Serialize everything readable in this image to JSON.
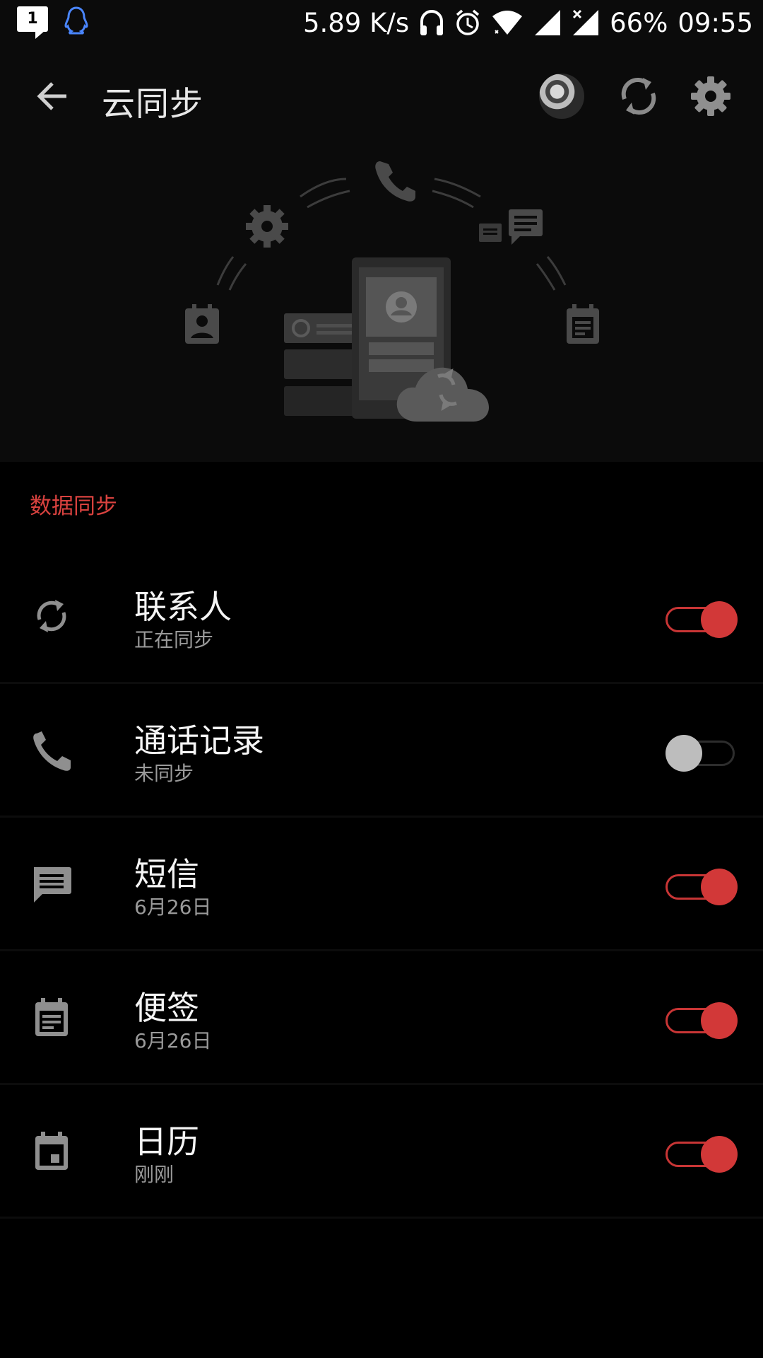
{
  "status_bar": {
    "notification_count": "1",
    "network_speed": "5.89 K/s",
    "battery": "66%",
    "time": "09:55",
    "icons": [
      "notification-badge-icon",
      "qq-penguin-icon",
      "headphones-icon",
      "alarm-icon",
      "wifi-icon",
      "signal-icon",
      "signal-no-sim-icon"
    ]
  },
  "app_bar": {
    "title": "云同步",
    "icons": [
      "back-arrow-icon",
      "avatar",
      "sync-icon",
      "gear-icon"
    ]
  },
  "section": {
    "title": "数据同步"
  },
  "items": [
    {
      "icon": "sync-icon",
      "title": "联系人",
      "subtitle": "正在同步",
      "enabled": true
    },
    {
      "icon": "phone-icon",
      "title": "通话记录",
      "subtitle": "未同步",
      "enabled": false
    },
    {
      "icon": "message-icon",
      "title": "短信",
      "subtitle": "6月26日",
      "enabled": true
    },
    {
      "icon": "note-icon",
      "title": "便签",
      "subtitle": "6月26日",
      "enabled": true
    },
    {
      "icon": "calendar-icon",
      "title": "日历",
      "subtitle": "刚刚",
      "enabled": true
    }
  ],
  "colors": {
    "accent": "#d23838",
    "background": "#000000",
    "appbar": "#0b0b0b",
    "section_header": "#d9423f"
  }
}
